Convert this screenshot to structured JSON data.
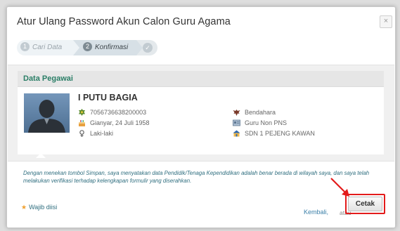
{
  "dialog": {
    "title": "Atur Ulang Password Akun Calon Guru Agama",
    "close_glyph": "×"
  },
  "steps": [
    {
      "number": "1",
      "label": "Cari Data",
      "state": "done"
    },
    {
      "number": "2",
      "label": "Konfirmasi",
      "state": "active"
    },
    {
      "icon": "check-icon",
      "glyph": "✓",
      "state": "pending"
    }
  ],
  "employee": {
    "section_title": "Data Pegawai",
    "name": "I PUTU BAGIA",
    "id_number": "7056736638200003",
    "birth": "Gianyar, 24 Juli 1958",
    "gender": "Laki-laki",
    "position": "Bendahara",
    "status": "Guru Non PNS",
    "school": "SDN 1 PEJENG KAWAN"
  },
  "notice": "Dengan menekan tombol Simpan, saya menyatakan data Pendidik/Tenaga Kependidikan adalah benar berada di wilayah saya, dan saya telah melakukan verifikasi terhadap kelengkapan formulir yang diserahkan.",
  "footer": {
    "required_label": "Wajib diisi",
    "required_glyph": "★",
    "back_label": "Kembali,",
    "or_label": "atau",
    "print_label": "Cetak"
  },
  "colors": {
    "section_title": "#2a7e66",
    "notice_text": "#2f6e7f",
    "highlight": "#e31b1b"
  },
  "icons": {
    "id": "badge-icon",
    "birth": "cake-icon",
    "gender": "gender-icon",
    "position": "eagle-icon",
    "status": "card-icon",
    "school": "school-icon"
  }
}
